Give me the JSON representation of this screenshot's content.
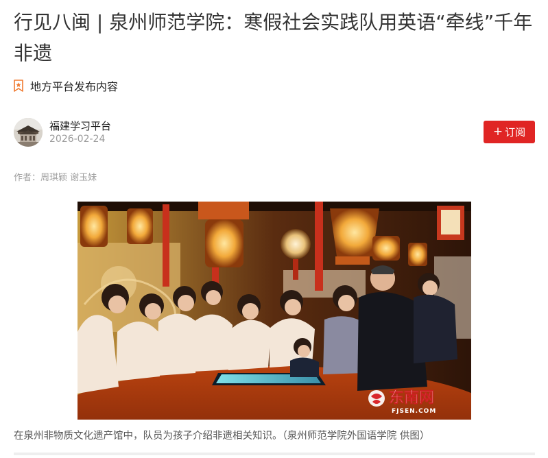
{
  "article": {
    "title": "行见八闽 | 泉州师范学院：寒假社会实践队用英语“牵线”千年非遗",
    "source_label": "地方平台发布内容",
    "byline": "作者：周琪颖 谢玉妹",
    "caption": "在泉州非物质文化遗产馆中，队员为孩子介绍非遗相关知识。（泉州师范学院外国语学院 供图）"
  },
  "author": {
    "name": "福建学习平台",
    "date": "2026-02-24"
  },
  "subscribe": {
    "plus": "+",
    "label": "订阅"
  },
  "photo": {
    "watermark_brand": "东南网",
    "watermark_domain": "FJSEN.COM"
  },
  "icons": {
    "source": "star-bookmark-icon",
    "avatar": "building-avatar"
  },
  "colors": {
    "accent": "#e02524",
    "source_icon": "#f07a30",
    "muted": "#9a9a9a"
  }
}
